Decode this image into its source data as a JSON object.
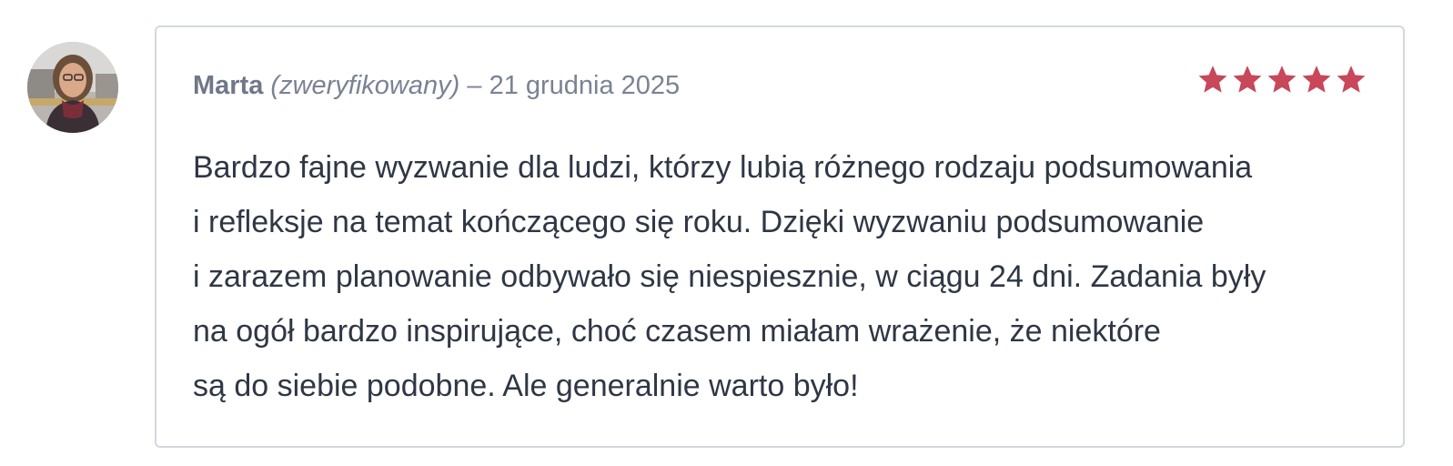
{
  "review": {
    "author": "Marta",
    "verified_label": "(zweryfikowany)",
    "date_separator": "–",
    "date": "21 grudnia 2025",
    "rating": 5,
    "rating_max": 5,
    "star_color": "#c8475a",
    "text_lines": [
      "Bardzo fajne wyzwanie dla ludzi, którzy lubią różnego rodzaju podsumowania",
      "i refleksje na temat kończącego się roku. Dzięki wyzwaniu podsumowanie",
      "i zarazem planowanie odbywało się niespiesznie, w ciągu 24 dni. Zadania były",
      "na ogół bardzo inspirujące, choć czasem miałam wrażenie, że niektóre",
      "są do siebie podobne. Ale generalnie warto było!"
    ]
  }
}
